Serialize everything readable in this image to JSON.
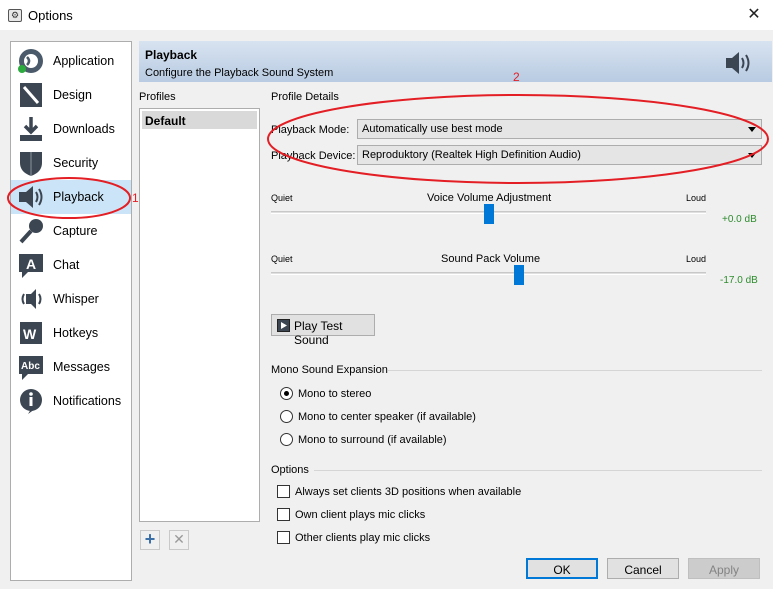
{
  "window": {
    "title": "Options",
    "close_glyph": "✕",
    "app_icon_glyph": "⚙"
  },
  "nav": {
    "items": [
      {
        "label": "Application",
        "icon": "teamspeak-logo-icon"
      },
      {
        "label": "Design",
        "icon": "pencil-icon"
      },
      {
        "label": "Downloads",
        "icon": "download-icon"
      },
      {
        "label": "Security",
        "icon": "shield-icon"
      },
      {
        "label": "Playback",
        "icon": "speaker-icon",
        "active": true
      },
      {
        "label": "Capture",
        "icon": "microphone-icon"
      },
      {
        "label": "Chat",
        "icon": "chat-icon"
      },
      {
        "label": "Whisper",
        "icon": "whisper-icon"
      },
      {
        "label": "Hotkeys",
        "icon": "hotkeys-icon"
      },
      {
        "label": "Messages",
        "icon": "messages-icon"
      },
      {
        "label": "Notifications",
        "icon": "info-icon"
      }
    ]
  },
  "header": {
    "title": "Playback",
    "subtitle": "Configure the Playback Sound System"
  },
  "profiles": {
    "label": "Profiles",
    "items": [
      "Default"
    ],
    "add_glyph": "+",
    "remove_glyph": "✕"
  },
  "details": {
    "label": "Profile Details",
    "playback_mode": {
      "label": "Playback Mode:",
      "value": "Automatically use best mode"
    },
    "playback_device": {
      "label": "Playback Device:",
      "value": "Reproduktory (Realtek High Definition Audio)"
    },
    "voice_volume": {
      "title": "Voice Volume Adjustment",
      "min_label": "Quiet",
      "max_label": "Loud",
      "value": "+0.0 dB",
      "position_fraction": 0.5
    },
    "sound_pack": {
      "title": "Sound Pack Volume",
      "min_label": "Quiet",
      "max_label": "Loud",
      "value": "-17.0 dB",
      "position_fraction": 0.57
    },
    "play_test": {
      "label": "Play Test Sound"
    }
  },
  "mono": {
    "label": "Mono Sound Expansion",
    "options": [
      "Mono to stereo",
      "Mono to center speaker (if available)",
      "Mono to surround (if available)"
    ],
    "selected": 0
  },
  "options": {
    "label": "Options",
    "checks": [
      "Always set clients 3D positions when available",
      "Own client plays mic clicks",
      "Other clients play mic clicks"
    ]
  },
  "buttons": {
    "ok": "OK",
    "cancel": "Cancel",
    "apply": "Apply"
  },
  "annotations": {
    "one": "1",
    "two": "2",
    "color": "#e31e24"
  },
  "colors": {
    "accent": "#0078d7",
    "selection": "#cce4f7",
    "db_green": "#2e8b2e"
  }
}
